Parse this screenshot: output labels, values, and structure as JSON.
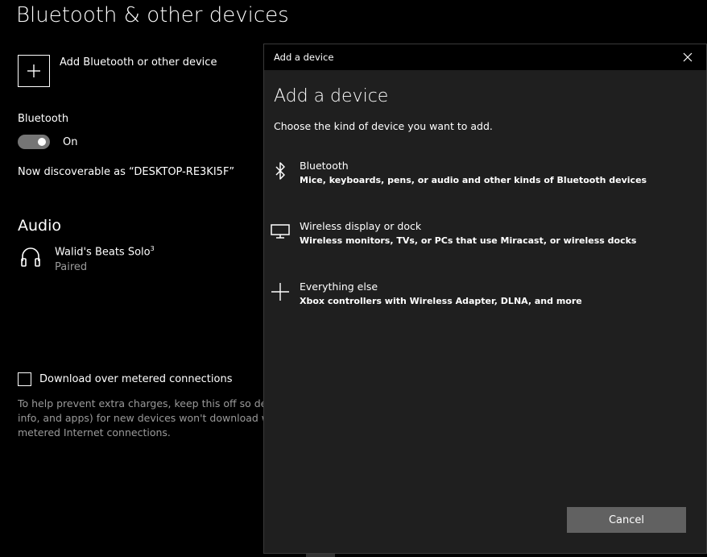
{
  "settings": {
    "title": "Bluetooth & other devices",
    "add_device_label": "Add Bluetooth or other device",
    "bluetooth_heading": "Bluetooth",
    "toggle_state": "On",
    "discoverable_text": "Now discoverable as “DESKTOP-RE3KI5F”",
    "audio_heading": "Audio",
    "audio_device": {
      "name": "Walid's Beats Solo",
      "superscript": "3",
      "status": "Paired"
    },
    "metered_label": "Download over metered connections",
    "metered_desc_lines": [
      "To help prevent extra charges, keep this off so dev",
      "info, and apps) for new devices won't download w",
      "metered Internet connections."
    ]
  },
  "dialog": {
    "window_title": "Add a device",
    "heading": "Add a device",
    "subheading": "Choose the kind of device you want to add.",
    "options": [
      {
        "title": "Bluetooth",
        "desc": "Mice, keyboards, pens, or audio and other kinds of Bluetooth devices",
        "icon": "bluetooth-icon"
      },
      {
        "title": "Wireless display or dock",
        "desc": "Wireless monitors, TVs, or PCs that use Miracast, or wireless docks",
        "icon": "monitor-icon"
      },
      {
        "title": "Everything else",
        "desc": "Xbox controllers with Wireless Adapter, DLNA, and more",
        "icon": "plus-icon"
      }
    ],
    "cancel_label": "Cancel"
  },
  "colors": {
    "page_bg": "#000000",
    "dialog_bg": "#1f1f1f",
    "toggle_track": "#757575",
    "secondary_text": "#9a9a9a",
    "cancel_button": "#616161"
  }
}
